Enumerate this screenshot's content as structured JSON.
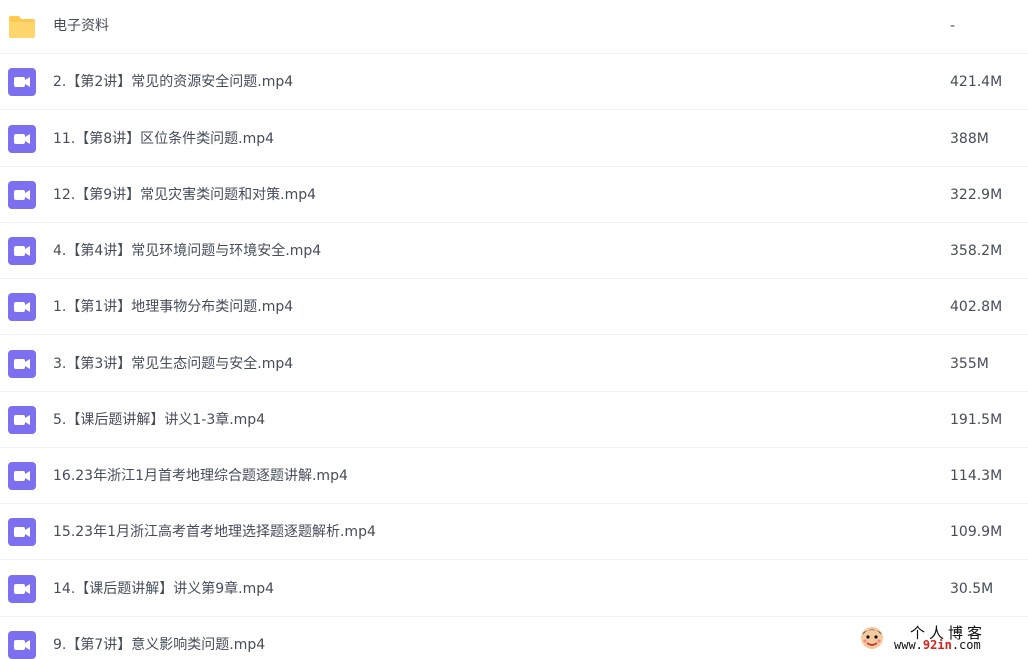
{
  "icons": {
    "folder_color": "#ffc94d",
    "video_color": "#7c6ff0"
  },
  "files": [
    {
      "icon": "folder-icon",
      "name": "电子资料",
      "size": "-"
    },
    {
      "icon": "video-file-icon",
      "name": "2.【第2讲】常见的资源安全问题.mp4",
      "size": "421.4M"
    },
    {
      "icon": "video-file-icon",
      "name": "11.【第8讲】区位条件类问题.mp4",
      "size": "388M"
    },
    {
      "icon": "video-file-icon",
      "name": "12.【第9讲】常见灾害类问题和对策.mp4",
      "size": "322.9M"
    },
    {
      "icon": "video-file-icon",
      "name": "4.【第4讲】常见环境问题与环境安全.mp4",
      "size": "358.2M"
    },
    {
      "icon": "video-file-icon",
      "name": "1.【第1讲】地理事物分布类问题.mp4",
      "size": "402.8M"
    },
    {
      "icon": "video-file-icon",
      "name": "3.【第3讲】常见生态问题与安全.mp4",
      "size": "355M"
    },
    {
      "icon": "video-file-icon",
      "name": "5.【课后题讲解】讲义1-3章.mp4",
      "size": "191.5M"
    },
    {
      "icon": "video-file-icon",
      "name": "16.23年浙江1月首考地理综合题逐题讲解.mp4",
      "size": "114.3M"
    },
    {
      "icon": "video-file-icon",
      "name": "15.23年1月浙江高考首考地理选择题逐题解析.mp4",
      "size": "109.9M"
    },
    {
      "icon": "video-file-icon",
      "name": "14.【课后题讲解】讲义第9章.mp4",
      "size": "30.5M"
    },
    {
      "icon": "video-file-icon",
      "name": "9.【第7讲】意义影响类问题.mp4",
      "size": ""
    }
  ],
  "watermark": {
    "title": "个人博客",
    "url_prefix": "www.",
    "url_highlight": "92in",
    "url_suffix": ".com"
  }
}
